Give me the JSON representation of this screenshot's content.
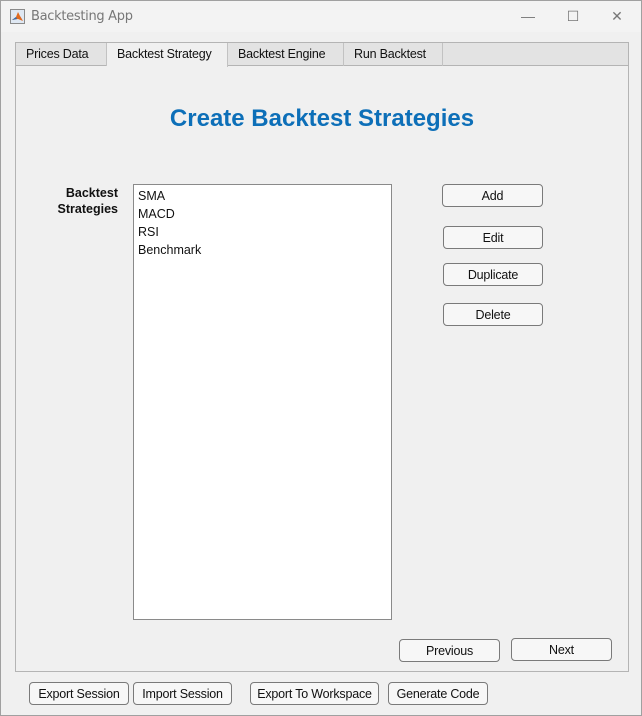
{
  "window": {
    "title": "Backtesting App",
    "icon": "matlab-icon",
    "controls": {
      "minimize": "—",
      "maximize": "☐",
      "close": "✕"
    }
  },
  "tabs": [
    {
      "label": "Prices Data",
      "active": false
    },
    {
      "label": "Backtest Strategy",
      "active": true
    },
    {
      "label": "Backtest Engine",
      "active": false
    },
    {
      "label": "Run Backtest",
      "active": false
    }
  ],
  "main": {
    "heading": "Create Backtest Strategies",
    "heading_color": "#0d6fb8",
    "list_label_line1": "Backtest",
    "list_label_line2": "Strategies",
    "strategies": [
      "SMA",
      "MACD",
      "RSI",
      "Benchmark"
    ],
    "buttons": {
      "add": "Add",
      "edit": "Edit",
      "duplicate": "Duplicate",
      "delete": "Delete"
    },
    "nav": {
      "previous": "Previous",
      "next": "Next"
    }
  },
  "footer": {
    "export_session": "Export Session",
    "import_session": "Import Session",
    "export_workspace": "Export To Workspace",
    "generate_code": "Generate Code"
  }
}
